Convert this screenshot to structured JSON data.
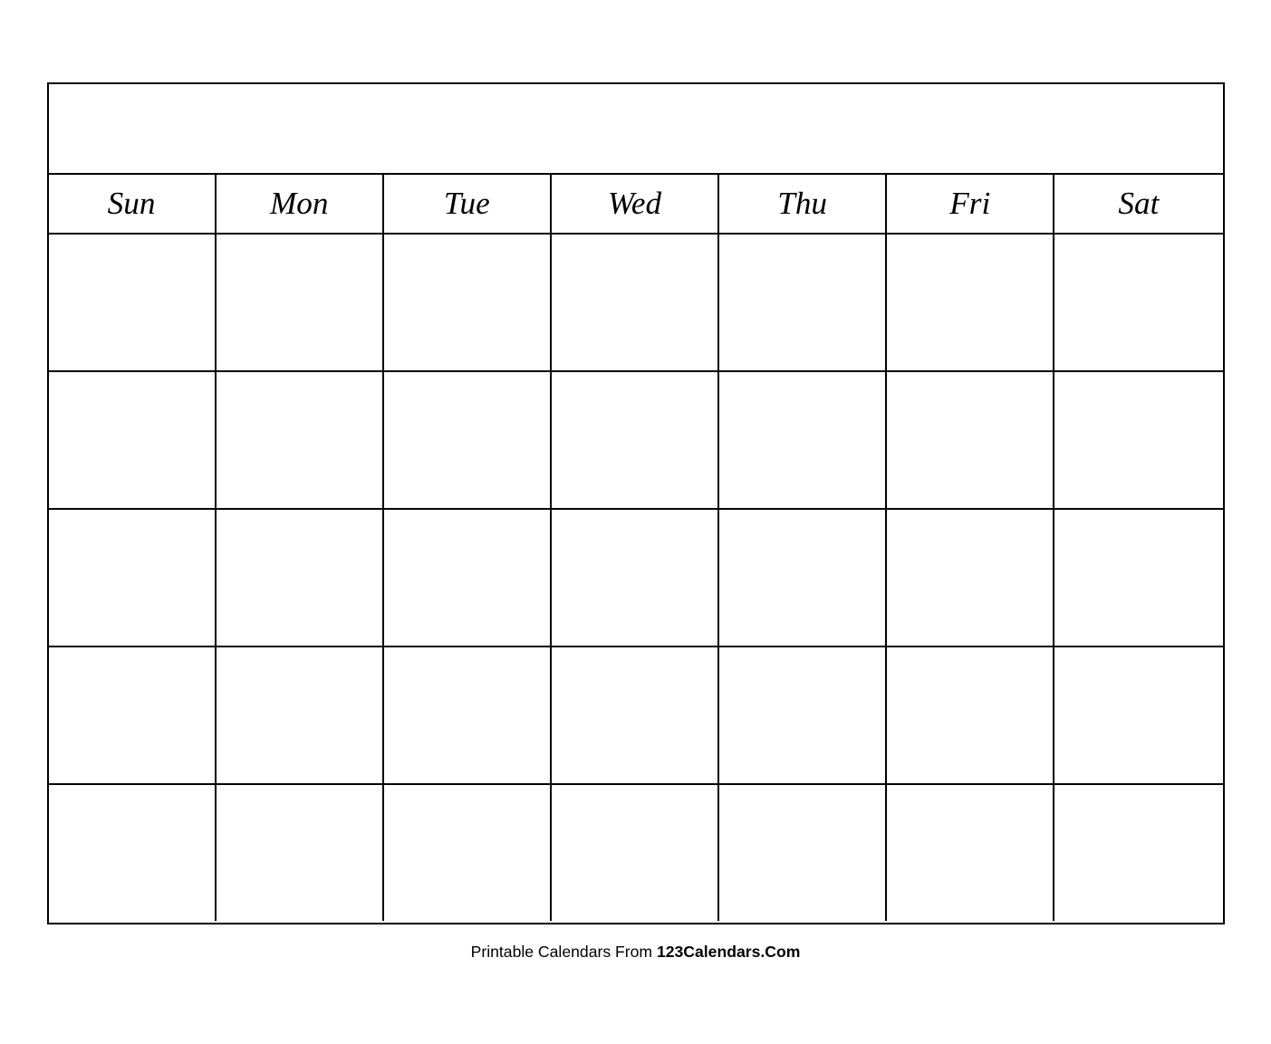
{
  "calendar": {
    "title": "",
    "days": [
      "Sun",
      "Mon",
      "Tue",
      "Wed",
      "Thu",
      "Fri",
      "Sat"
    ],
    "weeks": [
      [
        "",
        "",
        "",
        "",
        "",
        "",
        ""
      ],
      [
        "",
        "",
        "",
        "",
        "",
        "",
        ""
      ],
      [
        "",
        "",
        "",
        "",
        "",
        "",
        ""
      ],
      [
        "",
        "",
        "",
        "",
        "",
        "",
        ""
      ],
      [
        "",
        "",
        "",
        "",
        "",
        "",
        ""
      ]
    ]
  },
  "footer": {
    "prefix": "Printable Calendars From ",
    "brand": "123Calendars.Com"
  }
}
